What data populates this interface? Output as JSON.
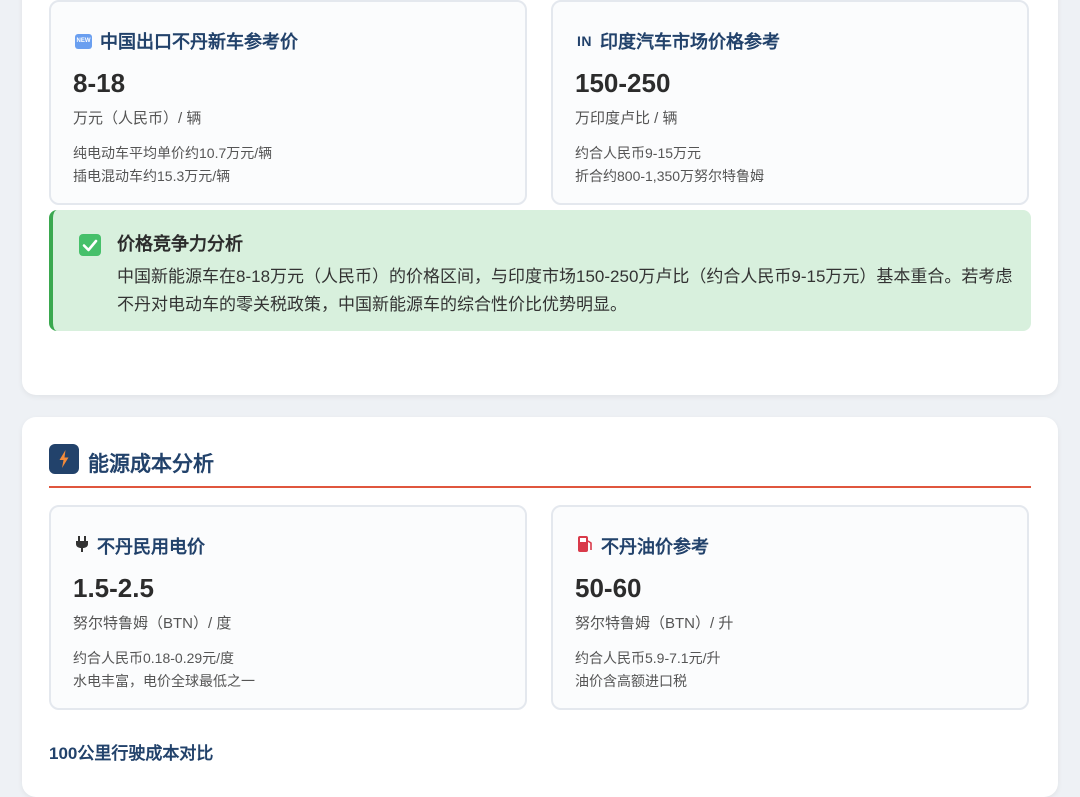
{
  "price_section": {
    "cards": [
      {
        "icon": "new-badge-icon",
        "title": "中国出口不丹新车参考价",
        "value": "8-18",
        "unit": "万元（人民币）/ 辆",
        "note1": "纯电动车平均单价约10.7万元/辆",
        "note2": "插电混动车约15.3万元/辆"
      },
      {
        "icon": "india-flag-icon",
        "icon_text": "IN",
        "title": "印度汽车市场价格参考",
        "value": "150-250",
        "unit": "万印度卢比 / 辆",
        "note1": "约合人民币9-15万元",
        "note2": "折合约800-1,350万努尔特鲁姆"
      }
    ],
    "analysis": {
      "title": "价格竞争力分析",
      "body": "中国新能源车在8-18万元（人民币）的价格区间，与印度市场150-250万卢比（约合人民币9-15万元）基本重合。若考虑不丹对电动车的零关税政策，中国新能源车的综合性价比优势明显。"
    }
  },
  "energy_section": {
    "icon": "lightning-icon",
    "title": "能源成本分析",
    "cards": [
      {
        "icon": "plug-icon",
        "title": "不丹民用电价",
        "value": "1.5-2.5",
        "unit": "努尔特鲁姆（BTN）/ 度",
        "note1": "约合人民币0.18-0.29元/度",
        "note2": "水电丰富，电价全球最低之一"
      },
      {
        "icon": "fuel-pump-icon",
        "title": "不丹油价参考",
        "value": "50-60",
        "unit": "努尔特鲁姆（BTN）/ 升",
        "note1": "约合人民币5.9-7.1元/升",
        "note2": "油价含高额进口税"
      }
    ],
    "subtitle": "100公里行驶成本对比"
  },
  "colors": {
    "accent_navy": "#22426b",
    "divider_red": "#e0563e",
    "analysis_bg": "#d8f0dd",
    "analysis_border": "#3aa84f"
  }
}
